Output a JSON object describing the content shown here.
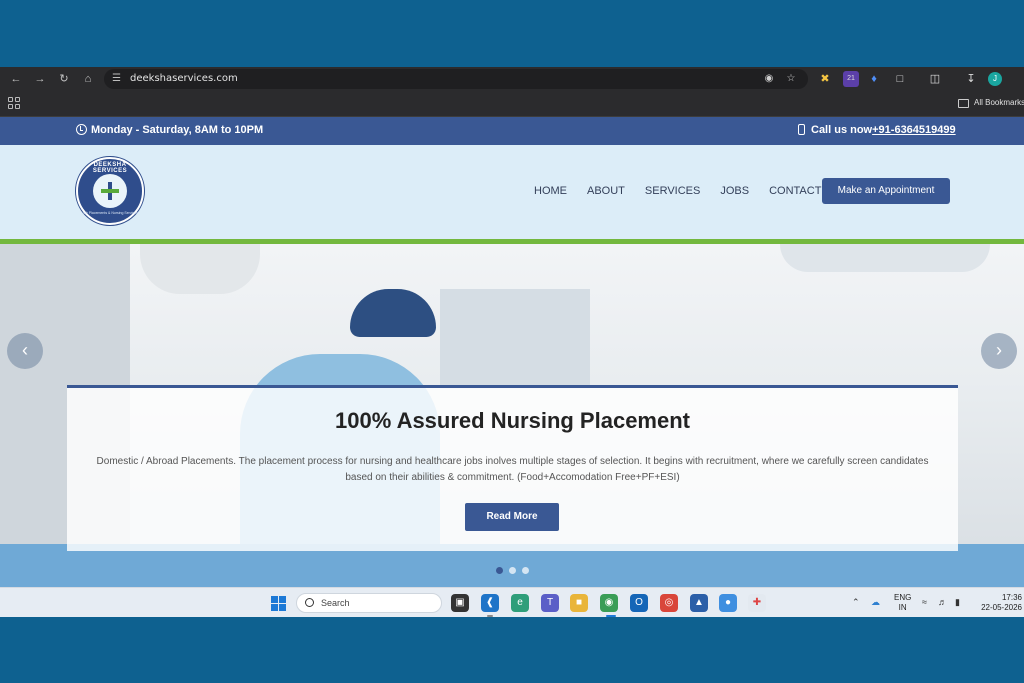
{
  "browser": {
    "url": "deekshaservices.com",
    "bookmarks_label": "All Bookmarks",
    "extension_badge": "21",
    "profile_initial": "J"
  },
  "topbar": {
    "hours": "Monday - Saturday, 8AM to 10PM",
    "call_label": "Call us now",
    "call_number": "+91-6364519499"
  },
  "logo": {
    "top_text": "DEEKSHA SERVICES",
    "bottom_text": "Job Placements & Nursing Services"
  },
  "nav": {
    "items": [
      "HOME",
      "ABOUT",
      "SERVICES",
      "JOBS",
      "CONTACT"
    ],
    "cta": "Make an Appointment"
  },
  "hero": {
    "title": "100% Assured Nursing Placement",
    "description": "Domestic / Abroad Placements. The placement process for nursing and healthcare jobs inolves multiple stages of selection. It begins with recruitment, where we carefully screen candidates based on their abilities & commitment. (Food+Accomodation Free+PF+ESI)",
    "button": "Read More",
    "prev_arrow": "‹",
    "next_arrow": "›",
    "slides": 3,
    "active_slide": 1
  },
  "taskbar": {
    "search_placeholder": "Search",
    "lang_line1": "ENG",
    "lang_line2": "IN",
    "time": "17:36",
    "date": "22-05-2026"
  },
  "colors": {
    "brand_blue": "#3a5894",
    "accent_green": "#73b83e",
    "header_bg": "#dcedf8",
    "desktop_bg": "#0e6190"
  }
}
